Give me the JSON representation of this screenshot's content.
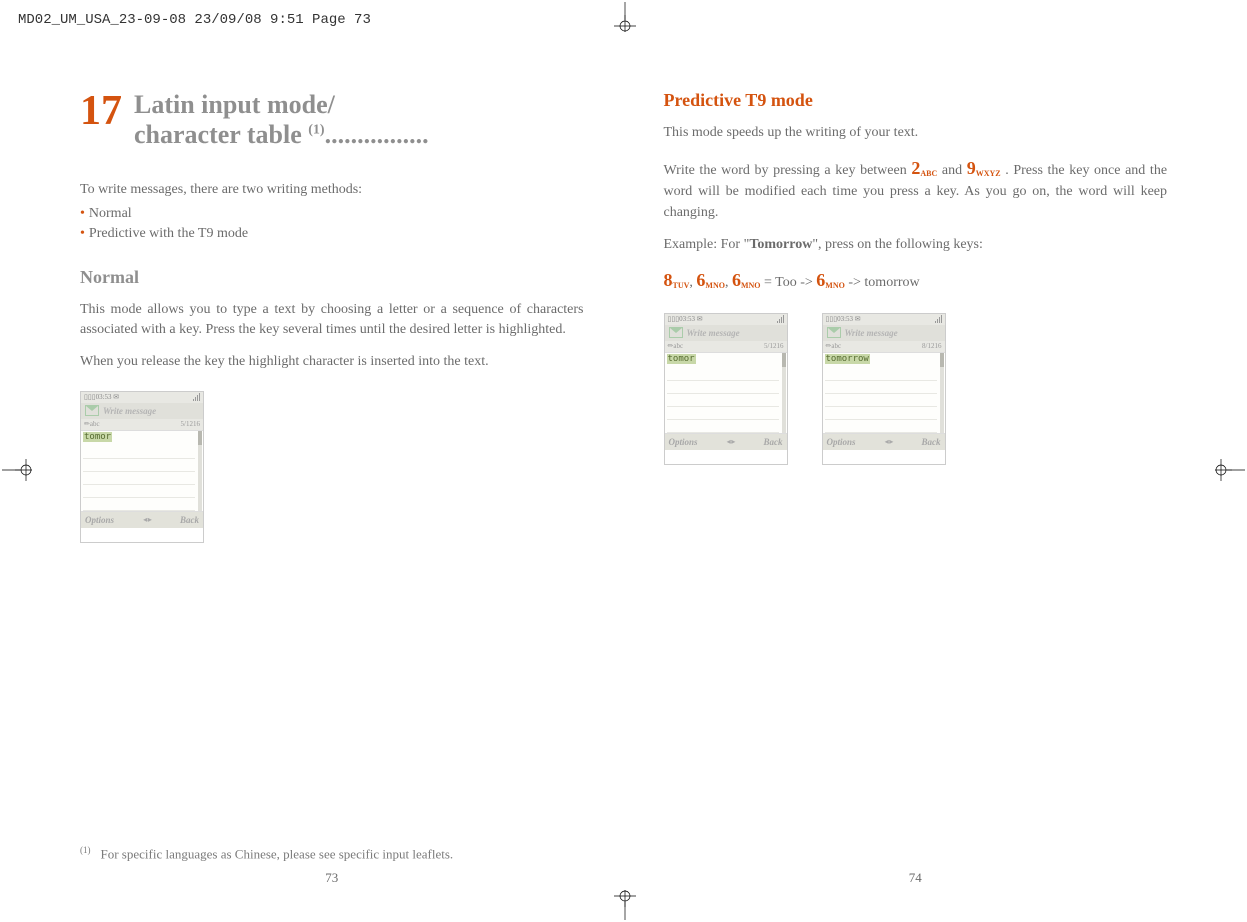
{
  "header": "MD02_UM_USA_23-09-08  23/09/08  9:51  Page 73",
  "left": {
    "chapter_number": "17",
    "chapter_title": "Latin input mode/\ncharacter table",
    "chapter_sup": "(1)",
    "dots": "................",
    "intro": "To write messages, there are two writing methods:",
    "bullets": [
      "Normal",
      "Predictive with the T9 mode"
    ],
    "section_heading": "Normal",
    "para1": "This mode allows you to type a text by choosing a letter or a sequence of characters associated with a key. Press the key several times until the desired letter is highlighted.",
    "para2": "When you release the key the highlight character is inserted into the text.",
    "footnote_ref": "(1)",
    "footnote_text": "For specific languages as Chinese, please see specific input leaflets.",
    "page_number": "73"
  },
  "right": {
    "section_heading": "Predictive T9 mode",
    "para1": "This mode speeds up the writing of your text.",
    "para2_pre": "Write the word by pressing a key between ",
    "key2": "2",
    "key2_sub": "ABC",
    "para2_mid": " and ",
    "key9": "9",
    "key9_sub": "WXYZ",
    "para2_post": ". Press the key once and the word will be modified each time you press a key. As you go on, the word will keep changing.",
    "example_label": "Example: For \"",
    "example_word": "Tomorrow",
    "example_post": "\", press on the following keys:",
    "seq_k8": "8",
    "seq_k8_sub": "TUV",
    "seq_comma": ", ",
    "seq_k6a": "6",
    "seq_k6a_sub": "MNO",
    "seq_k6b": "6",
    "seq_k6b_sub": "MNO",
    "seq_mid": " = Too ->",
    "seq_k6c": "6",
    "seq_k6c_sub": "MNO",
    "seq_end": " -> tomorrow",
    "page_number": "74"
  },
  "phone": {
    "time": "03:53",
    "title": "Write message",
    "mode": "abc",
    "counter": "5/1216",
    "counter2": "8/1216",
    "word1": "tomor",
    "word2": "tomorrow",
    "softkey_left": "Options",
    "softkey_right": "Back"
  }
}
